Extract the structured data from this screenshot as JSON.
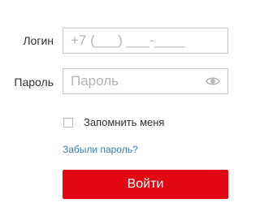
{
  "form": {
    "login_label": "Логин",
    "login_placeholder": "+7 (___) ___-____",
    "password_label": "Пароль",
    "password_placeholder": "Пароль",
    "password_toggle_icon": "eye-icon",
    "remember_label": "Запомнить меня",
    "remember_checked": false,
    "forgot_link": "Забыли пароль?",
    "submit_label": "Войти"
  },
  "colors": {
    "accent": "#e30613",
    "link": "#3a7bbf",
    "border": "#c9c9c9",
    "text": "#333333"
  }
}
